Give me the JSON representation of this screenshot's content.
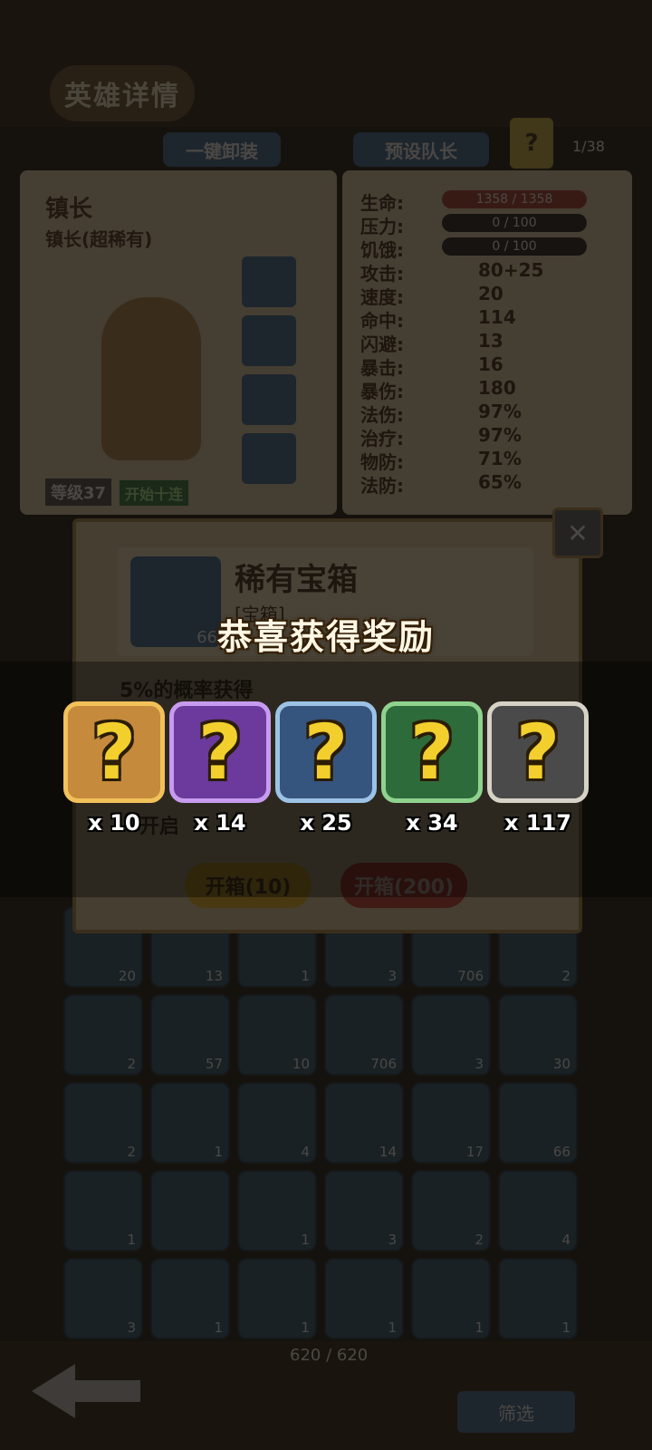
{
  "background": {
    "screen_title": "英雄详情",
    "unequip_all_label": "一键卸装",
    "preset_captain_label": "预设队长",
    "help_label": "?",
    "page_indicator": "1/38",
    "hero": {
      "name": "镇长",
      "subtitle": "镇长(超稀有)",
      "level_label": "等级37",
      "status_label": "开始十连"
    },
    "stats": [
      {
        "label": "生命:",
        "value": "1358 / 1358",
        "bar": "hp"
      },
      {
        "label": "压力:",
        "value": "0 / 100",
        "bar": "dark"
      },
      {
        "label": "饥饿:",
        "value": "0 / 100",
        "bar": "dark"
      },
      {
        "label": "攻击:",
        "value": "80+25"
      },
      {
        "label": "速度:",
        "value": "20"
      },
      {
        "label": "命中:",
        "value": "114"
      },
      {
        "label": "闪避:",
        "value": "13"
      },
      {
        "label": "暴击:",
        "value": "16"
      },
      {
        "label": "暴伤:",
        "value": "180"
      },
      {
        "label": "法伤:",
        "value": "97%"
      },
      {
        "label": "治疗:",
        "value": "97%"
      },
      {
        "label": "物防:",
        "value": "71%"
      },
      {
        "label": "法防:",
        "value": "65%"
      }
    ],
    "inventory_row1": [
      "20",
      "13",
      "1",
      "3",
      "706",
      "2"
    ],
    "inventory_row2": [
      "2",
      "57",
      "10",
      "706",
      "3",
      "30"
    ],
    "inventory_row3": [
      "2",
      "1",
      "4",
      "14",
      "17",
      "66"
    ],
    "inventory_row4": [
      "1",
      "",
      "1",
      "3",
      "2",
      "4"
    ],
    "inventory_row5": [
      "3",
      "1",
      "1",
      "1",
      "1",
      "1"
    ],
    "inventory_count": "620 / 620",
    "filter_label": "筛选"
  },
  "item_popup": {
    "name": "稀有宝箱",
    "type": "[宝箱]",
    "count": "66",
    "description": "5%的概率获得",
    "note": "开启",
    "open10_label": "开箱(10)",
    "open200_label": "开箱(200)"
  },
  "reward": {
    "title": "恭喜获得奖励",
    "items": [
      {
        "name": "orange-mystery-item",
        "count": "x 10",
        "color": "#c58a3c",
        "border": "#f2c15a"
      },
      {
        "name": "purple-mystery-item",
        "count": "x 14",
        "color": "#6b3a9c",
        "border": "#c79bef"
      },
      {
        "name": "blue-mystery-item",
        "count": "x 25",
        "color": "#35557f",
        "border": "#9cc3e6"
      },
      {
        "name": "green-mystery-item",
        "count": "x 34",
        "color": "#2e6b3b",
        "border": "#8fd28e"
      },
      {
        "name": "gray-mystery-item",
        "count": "x 117",
        "color": "#4a4a4a",
        "border": "#d7d2c6"
      }
    ]
  }
}
